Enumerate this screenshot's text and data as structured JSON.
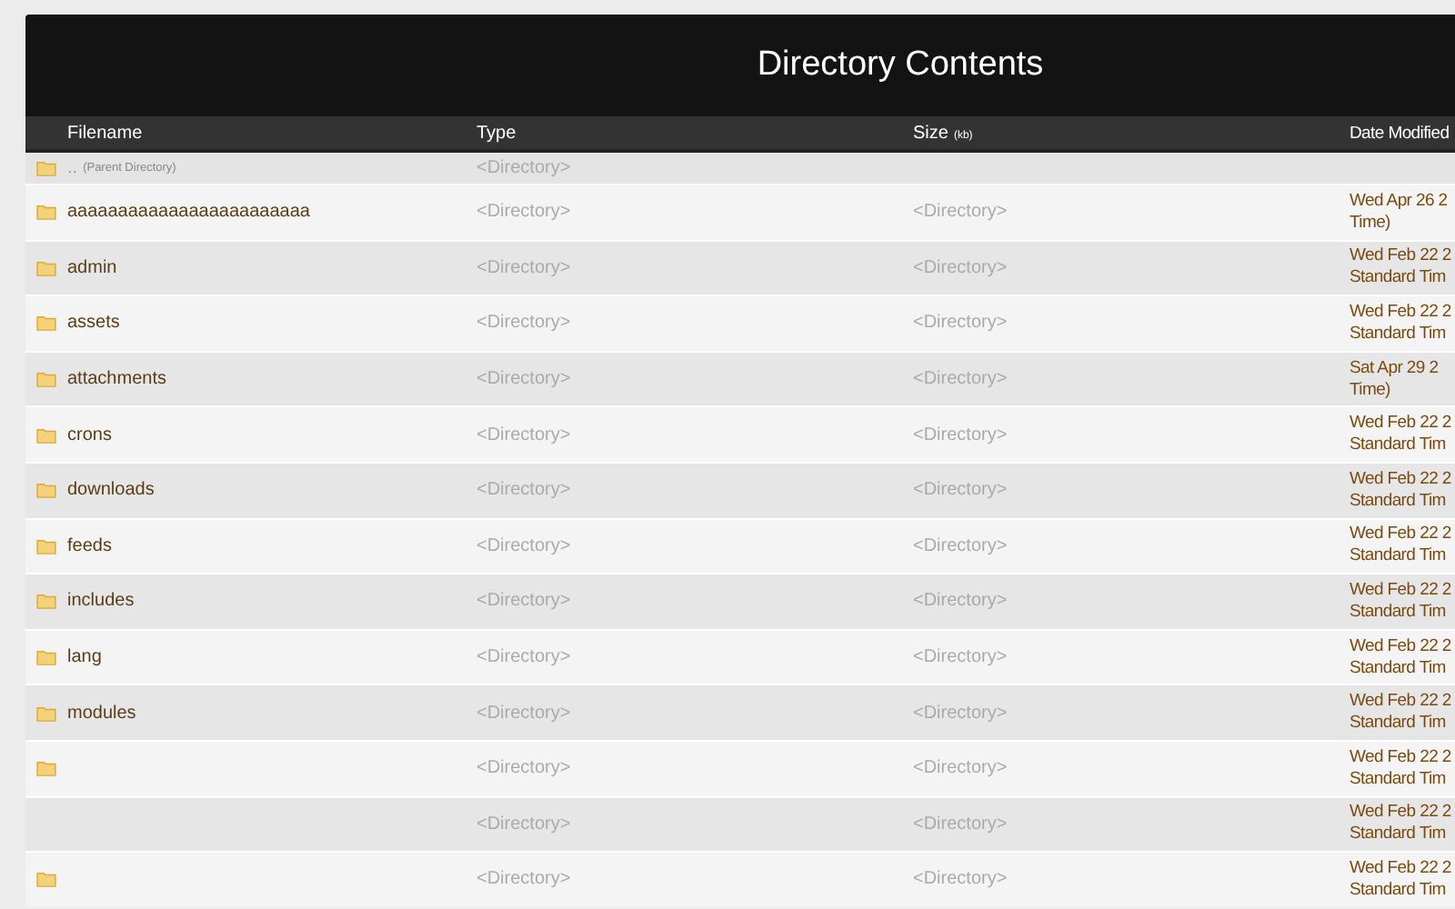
{
  "title": "Directory Contents",
  "columns": [
    {
      "label": "Filename"
    },
    {
      "label": "Type"
    },
    {
      "label": "Size",
      "unit": "(kb)"
    },
    {
      "label": "Date Modified"
    }
  ],
  "parent": {
    "name": "..",
    "note": "(Parent Directory)",
    "type": "<Directory>"
  },
  "rows": [
    {
      "name": "aaaaaaaaaaaaaaaaaaaaaaaa",
      "folder_icon": true,
      "type": "<Directory>",
      "size": "<Directory>",
      "date": [
        "Wed Apr 26 2",
        "Time)"
      ]
    },
    {
      "name": "admin",
      "folder_icon": true,
      "type": "<Directory>",
      "size": "<Directory>",
      "date": [
        "Wed Feb 22 2",
        "Standard Tim"
      ]
    },
    {
      "name": "assets",
      "folder_icon": true,
      "type": "<Directory>",
      "size": "<Directory>",
      "date": [
        "Wed Feb 22 2",
        "Standard Tim"
      ]
    },
    {
      "name": "attachments",
      "folder_icon": true,
      "type": "<Directory>",
      "size": "<Directory>",
      "date": [
        "Sat Apr 29 2",
        "Time)"
      ]
    },
    {
      "name": "crons",
      "folder_icon": true,
      "type": "<Directory>",
      "size": "<Directory>",
      "date": [
        "Wed Feb 22 2",
        "Standard Tim"
      ]
    },
    {
      "name": "downloads",
      "folder_icon": true,
      "type": "<Directory>",
      "size": "<Directory>",
      "date": [
        "Wed Feb 22 2",
        "Standard Tim"
      ]
    },
    {
      "name": "feeds",
      "folder_icon": true,
      "type": "<Directory>",
      "size": "<Directory>",
      "date": [
        "Wed Feb 22 2",
        "Standard Tim"
      ]
    },
    {
      "name": "includes",
      "folder_icon": true,
      "type": "<Directory>",
      "size": "<Directory>",
      "date": [
        "Wed Feb 22 2",
        "Standard Tim"
      ]
    },
    {
      "name": "lang",
      "folder_icon": true,
      "type": "<Directory>",
      "size": "<Directory>",
      "date": [
        "Wed Feb 22 2",
        "Standard Tim"
      ]
    },
    {
      "name": "modules",
      "folder_icon": true,
      "type": "<Directory>",
      "size": "<Directory>",
      "date": [
        "Wed Feb 22 2",
        "Standard Tim"
      ]
    },
    {
      "folder_icon": true,
      "type": "<Directory>",
      "size": "<Directory>",
      "date": [
        "Wed Feb 22 2",
        "Standard Tim"
      ]
    },
    {
      "folder_icon": false,
      "type": "<Directory>",
      "size": "<Directory>",
      "date": [
        "Wed Feb 22 2",
        "Standard Tim"
      ]
    },
    {
      "folder_icon": true,
      "type": "<Directory>",
      "size": "<Directory>",
      "date": [
        "Wed Feb 22 2",
        "Standard Tim"
      ]
    }
  ]
}
